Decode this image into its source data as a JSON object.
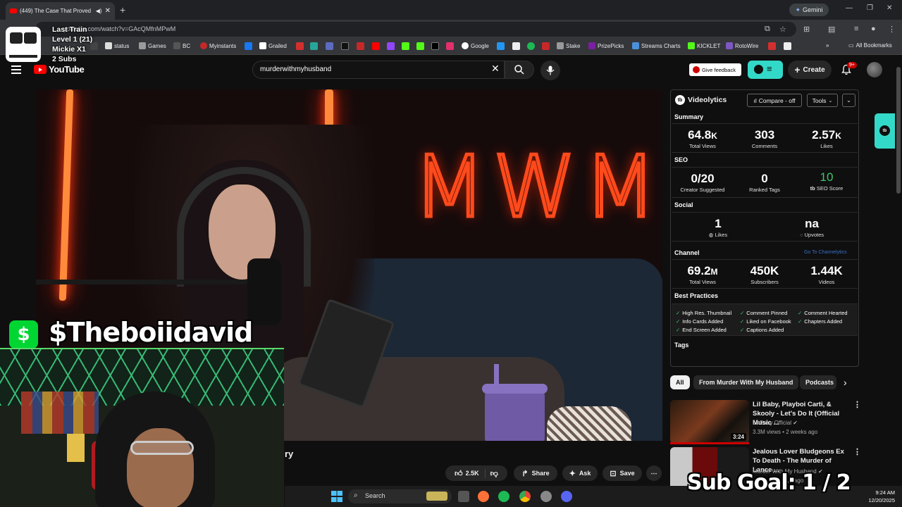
{
  "browser": {
    "tab_title": "(449) The Case That Proved",
    "url": "youtube.com/watch?v=GAcQMfnMPwM",
    "gemini_label": "Gemini",
    "all_bookmarks": "All Bookmarks",
    "bookmarks": [
      "status",
      "Games",
      "BC",
      "Myinstants",
      "Grailed",
      "Google",
      "Stake",
      "PrizePicks",
      "Streams Charts",
      "KICKLET",
      "RotoWire"
    ]
  },
  "stream_overlay": {
    "train_title": "Last Train",
    "train_level": "Level 1  (21)",
    "train_mickie": "Mickie X1",
    "train_subs": "2 Subs",
    "cashtag": "$Theboiidavid",
    "sub_goal": "Sub Goal:  1 / 2"
  },
  "youtube": {
    "logo": "YouTube",
    "search_value": "murderwithmyhusband",
    "give_feedback": "Give feedback",
    "create": "Create",
    "notif_count": "9+",
    "title_fragment": "ry",
    "likes": "2.5K",
    "share": "Share",
    "ask": "Ask",
    "save": "Save"
  },
  "videolytics": {
    "name": "Videolytics",
    "compare": "Compare - off",
    "tools": "Tools",
    "summary_label": "Summary",
    "summary": [
      {
        "value": "64.8",
        "suffix": "K",
        "label": "Total Views"
      },
      {
        "value": "303",
        "suffix": "",
        "label": "Comments"
      },
      {
        "value": "2.57",
        "suffix": "K",
        "label": "Likes"
      }
    ],
    "seo_label": "SEO",
    "seo": [
      {
        "value": "0/20",
        "label": "Creator Suggested"
      },
      {
        "value": "0",
        "label": "Ranked Tags"
      },
      {
        "value": "10",
        "label": "SEO Score"
      }
    ],
    "social_label": "Social",
    "social": [
      {
        "value": "1",
        "label": "Likes"
      },
      {
        "value": "na",
        "label": "Upvotes"
      }
    ],
    "channel_label": "Channel",
    "channel_link": "Go To Channelytics",
    "channel": [
      {
        "value": "69.2",
        "suffix": "M",
        "label": "Total Views"
      },
      {
        "value": "450K",
        "suffix": "",
        "label": "Subscribers"
      },
      {
        "value": "1.44K",
        "suffix": "",
        "label": "Videos"
      }
    ],
    "best_practices_label": "Best Practices",
    "best_practices": [
      "High Res. Thumbnail",
      "Comment Pinned",
      "Comment Hearted",
      "Info Cards Added",
      "Liked on Facebook",
      "Chapters Added",
      "End Screen Added",
      "Captions Added"
    ],
    "tags_label": "Tags"
  },
  "chips": [
    "All",
    "From Murder With My Husband",
    "Podcasts"
  ],
  "recommendations": [
    {
      "title": "Lil Baby, Playboi Carti, & Skooly - Let's Do It (Official Music ...",
      "channel": "Lil Baby Official",
      "meta": "3.3M views • 2 weeks ago",
      "duration": "3:24"
    },
    {
      "title": "Jealous Lover Bludgeons Ex To Death - The Murder of Lance ...",
      "channel": "Murder With My Husband",
      "meta": "4 days ago",
      "duration": ""
    }
  ],
  "taskbar": {
    "search": "Search",
    "time": "9:24 AM",
    "date": "12/20/2025"
  },
  "colors": {
    "accent_teal": "#33d9c8",
    "youtube_red": "#ff0000",
    "cashapp_green": "#00d632",
    "check_green": "#3ec46d"
  }
}
